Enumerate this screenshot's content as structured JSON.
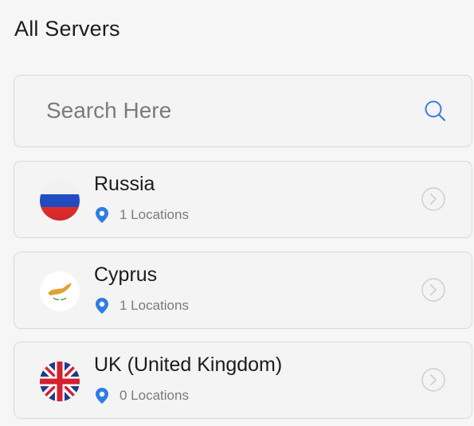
{
  "header": {
    "title": "All Servers"
  },
  "search": {
    "placeholder": "Search Here",
    "icon": "search-icon"
  },
  "servers": [
    {
      "name": "Russia",
      "locations": "1 Locations",
      "flag": "russia-flag-icon"
    },
    {
      "name": "Cyprus",
      "locations": "1 Locations",
      "flag": "cyprus-flag-icon"
    },
    {
      "name": "UK (United Kingdom)",
      "locations": "0 Locations",
      "flag": "uk-flag-icon"
    }
  ],
  "colors": {
    "accent": "#2f7de1",
    "border": "#d9d9d9",
    "background": "#f6f6f6"
  }
}
